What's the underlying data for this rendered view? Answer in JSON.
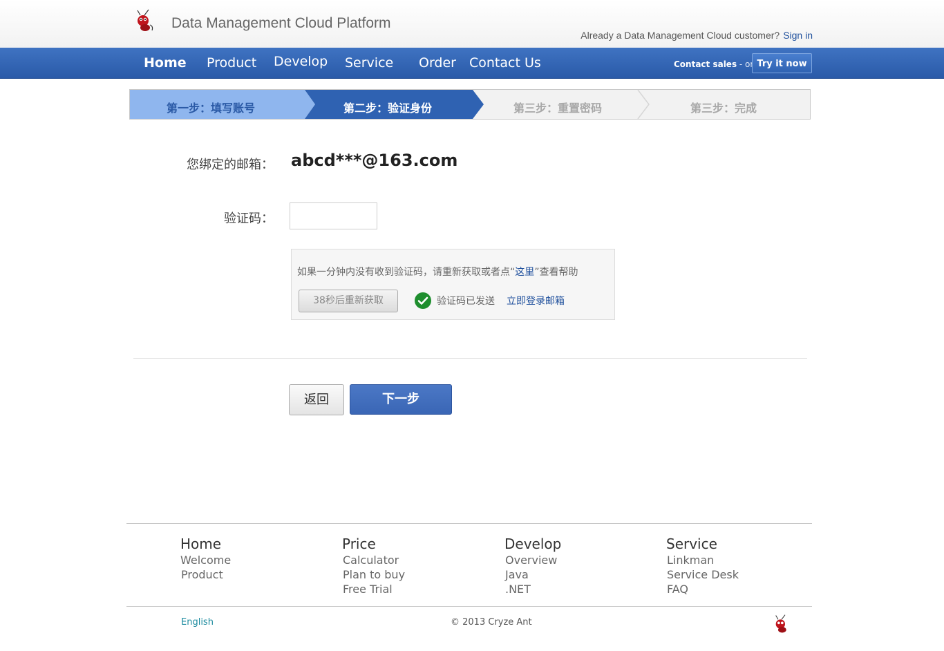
{
  "header": {
    "brand": "Data Management Cloud Platform",
    "customer_prompt": "Already a Data Management Cloud customer?",
    "sign_in": "Sign in"
  },
  "nav": {
    "items": [
      {
        "label": "Home"
      },
      {
        "label": "Product"
      },
      {
        "label": "Develop"
      },
      {
        "label": "Service"
      },
      {
        "label": "Order"
      },
      {
        "label": "Contact Us"
      }
    ],
    "contact_sales": "Contact sales",
    "or": " - or - ",
    "try_now": "Try it now"
  },
  "steps": [
    {
      "label": "第一步：填写账号",
      "state": "done"
    },
    {
      "label": "第二步：验证身份",
      "state": "active"
    },
    {
      "label": "第三步：重置密码",
      "state": "pending"
    },
    {
      "label": "第三步：完成",
      "state": "pending"
    }
  ],
  "form": {
    "email_label": "您绑定的邮箱：",
    "email_value": "abcd***@163.com",
    "code_label": "验证码：",
    "code_value": "",
    "help_prefix": "如果一分钟内没有收到验证码，请重新获取或者点“",
    "help_link": "这里",
    "help_suffix": "”查看帮助",
    "resend_button": "38秒后重新获取",
    "sent_status": "验证码已发送",
    "login_mail_link": "立即登录邮箱",
    "back_button": "返回",
    "next_button": "下一步"
  },
  "footer": {
    "columns": [
      {
        "heading": "Home",
        "links": [
          "Welcome",
          "Product"
        ]
      },
      {
        "heading": "Price",
        "links": [
          "Calculator",
          "Plan to buy",
          "Free Trial"
        ]
      },
      {
        "heading": "Develop",
        "links": [
          "Overview",
          "Java",
          ".NET"
        ]
      },
      {
        "heading": "Service",
        "links": [
          "Linkman",
          "Service Desk",
          "FAQ"
        ]
      }
    ],
    "language": "English",
    "copyright": "© 2013 Cryze Ant"
  },
  "colors": {
    "nav_blue": "#2f62b2",
    "step_done": "#8fb6ee",
    "step_active": "#2f62b2",
    "link_blue": "#1e4f9c",
    "success_green": "#1e8e2e"
  }
}
